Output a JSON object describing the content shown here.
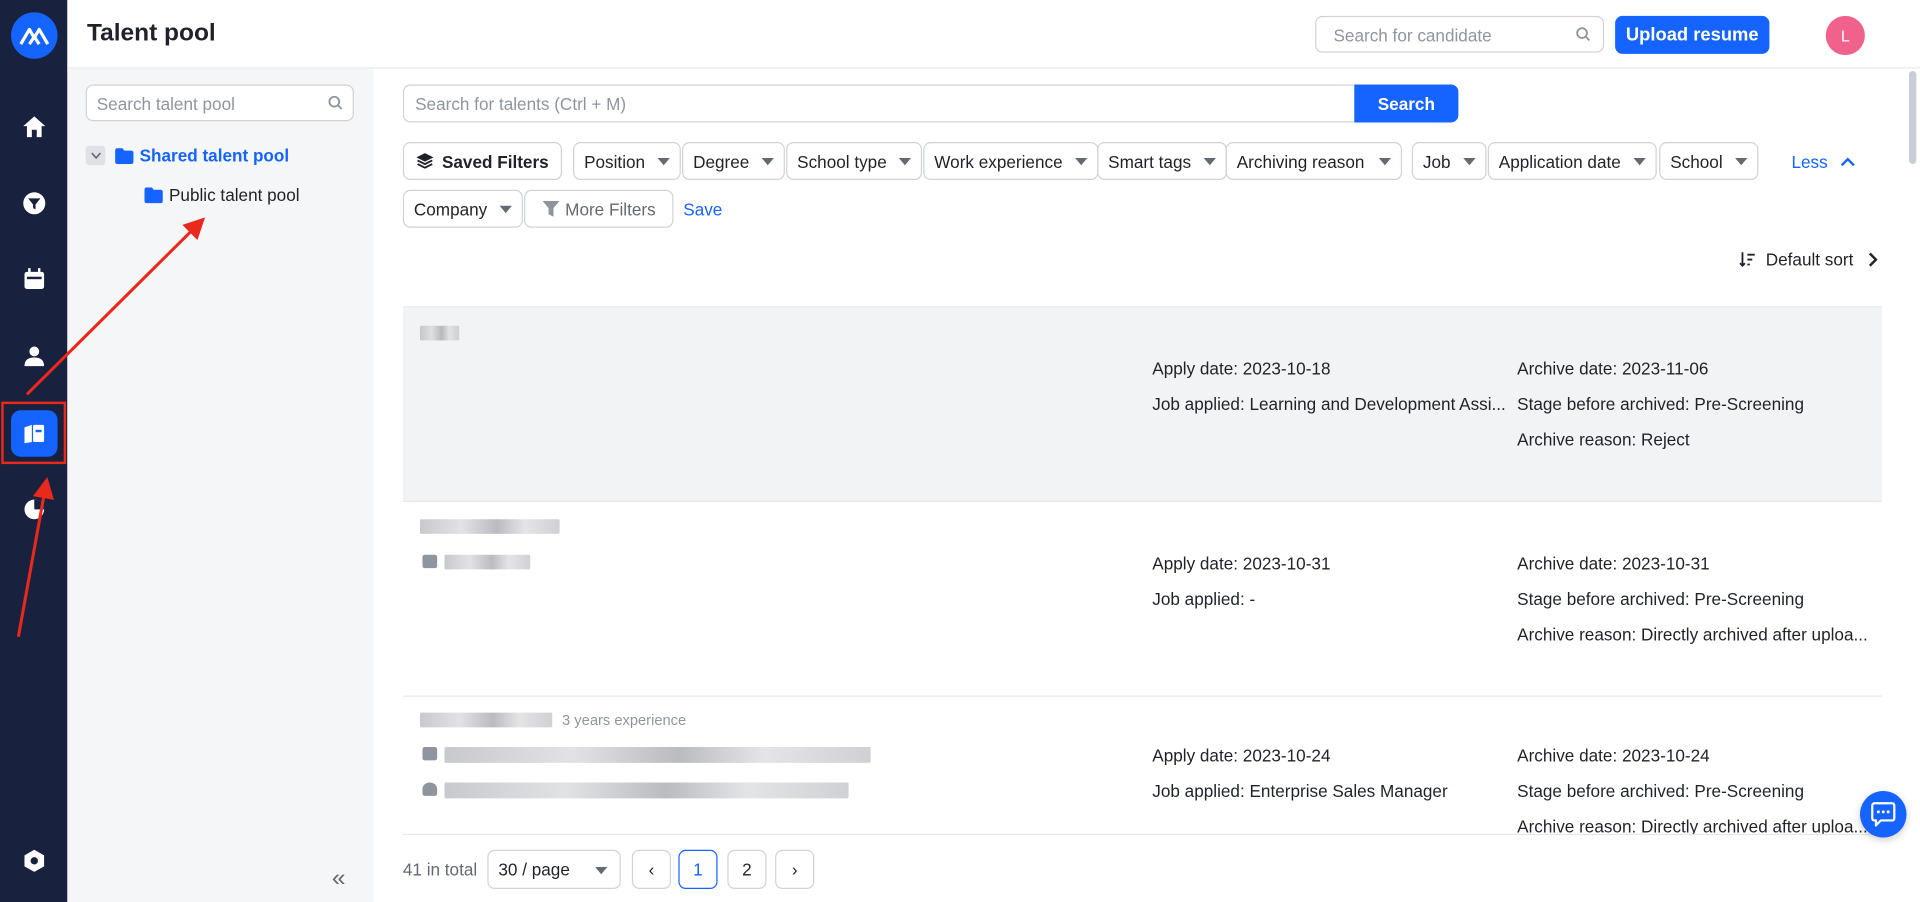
{
  "header": {
    "title": "Talent pool",
    "candidate_search_placeholder": "Search for candidate",
    "upload_label": "Upload resume",
    "avatar_initial": "L"
  },
  "tree": {
    "search_placeholder": "Search talent pool",
    "shared_label": "Shared talent pool",
    "public_label": "Public talent pool"
  },
  "search": {
    "placeholder": "Search for talents  (Ctrl + M)",
    "button_label": "Search"
  },
  "filters": {
    "saved_filters": "Saved Filters",
    "chips": [
      "Position",
      "Degree",
      "School type",
      "Work experience",
      "Smart tags",
      "Archiving reason",
      "Job",
      "Application date",
      "School",
      "Company"
    ],
    "less_label": "Less",
    "more_filters": "More Filters",
    "save_label": "Save"
  },
  "sort": {
    "label": "Default sort"
  },
  "rows": [
    {
      "apply_date": "Apply date: 2023-10-18",
      "job_applied": "Job applied: Learning and Development Assi...",
      "archive_date": "Archive date: 2023-11-06",
      "stage": "Stage before archived: Pre-Screening",
      "reason": "Archive reason: Reject"
    },
    {
      "apply_date": "Apply date: 2023-10-31",
      "job_applied": "Job applied: -",
      "archive_date": "Archive date: 2023-10-31",
      "stage": "Stage before archived: Pre-Screening",
      "reason": "Archive reason: Directly archived after uploa..."
    },
    {
      "experience": "3 years experience",
      "apply_date": "Apply date: 2023-10-24",
      "job_applied": "Job applied: Enterprise Sales Manager",
      "archive_date": "Archive date: 2023-10-24",
      "stage": "Stage before archived: Pre-Screening",
      "reason": "Archive reason: Directly archived after uploa..."
    }
  ],
  "pagination": {
    "total": "41 in total",
    "page_size": "30 / page",
    "prev": "‹",
    "pages": [
      "1",
      "2"
    ],
    "next": "›",
    "current": "1"
  },
  "colors": {
    "accent": "#1664ff",
    "nav_bg": "#18223e",
    "annotation": "#e8291c"
  }
}
